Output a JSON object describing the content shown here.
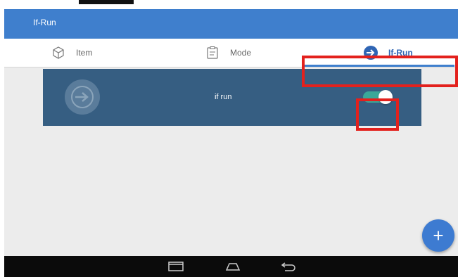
{
  "app_bar": {
    "title": "If-Run"
  },
  "tabs": [
    {
      "label": "Item",
      "icon": "cube-icon"
    },
    {
      "label": "Mode",
      "icon": "mode-icon"
    },
    {
      "label": "If-Run",
      "icon": "arrow-circle-icon",
      "selected": true
    }
  ],
  "card": {
    "label": "if run",
    "toggle_on": true,
    "icon": "arrow-circle-icon"
  },
  "fab": {
    "label": "+"
  },
  "nav": {
    "buttons": [
      "recent-apps-icon",
      "home-icon",
      "back-icon"
    ]
  },
  "colors": {
    "app_bar": "#3f7fcd",
    "card": "#365e82",
    "toggle_on": "#3aa899",
    "highlight": "#e3211d",
    "fab": "#3d7bd1",
    "nav_bar": "#0b0b0b",
    "content_bg": "#ececec"
  }
}
